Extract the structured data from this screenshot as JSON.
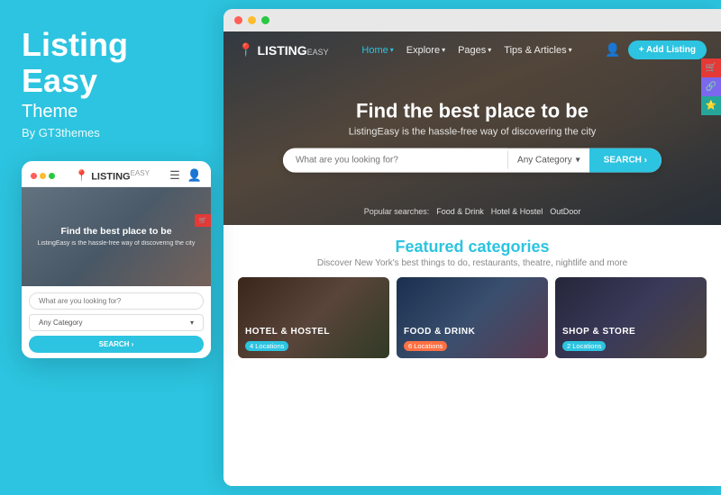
{
  "left": {
    "brand": "Listing Easy",
    "brand_line1": "Listing",
    "brand_line2": "Easy",
    "theme_label": "Theme",
    "by_label": "By GT3themes",
    "mobile": {
      "dots": [
        "red",
        "yellow",
        "green"
      ],
      "logo_text": "LISTING",
      "logo_easy": "EASY",
      "hero_title": "Find the best place to be",
      "hero_subtitle": "ListingEasy is the hassle-free way of discovering\nthe city",
      "search_placeholder": "What are you looking for?",
      "category_placeholder": "Any Category",
      "search_btn": "SEARCH ›"
    }
  },
  "right": {
    "browser_dots": [
      "red",
      "yellow",
      "green"
    ],
    "nav": {
      "logo_text": "LISTING",
      "logo_easy": "EASY",
      "links": [
        "Home",
        "Explore",
        "Pages",
        "Tips & Articles"
      ],
      "add_listing": "+ Add Listing"
    },
    "hero": {
      "title": "Find the best place to be",
      "subtitle": "ListingEasy is the hassle-free way of discovering the city",
      "search_placeholder": "What are you looking for?",
      "category_label": "Any Category",
      "search_btn": "SEARCH ›",
      "popular_label": "Popular searches:",
      "popular_tags": [
        "Food & Drink",
        "Hotel & Hostel",
        "OutDoor"
      ]
    },
    "featured": {
      "title": "Featured categories",
      "subtitle": "Discover New York's best things to do, restaurants, theatre, nightlife and more",
      "categories": [
        {
          "name": "HOTEL & HOSTEL",
          "badge": "4 Locations",
          "color": "hotel"
        },
        {
          "name": "FOOD & DRINK",
          "badge": "6 Locations",
          "color": "food"
        },
        {
          "name": "SHOP & STORE",
          "badge": "2 Locations",
          "color": "shop"
        }
      ]
    }
  }
}
